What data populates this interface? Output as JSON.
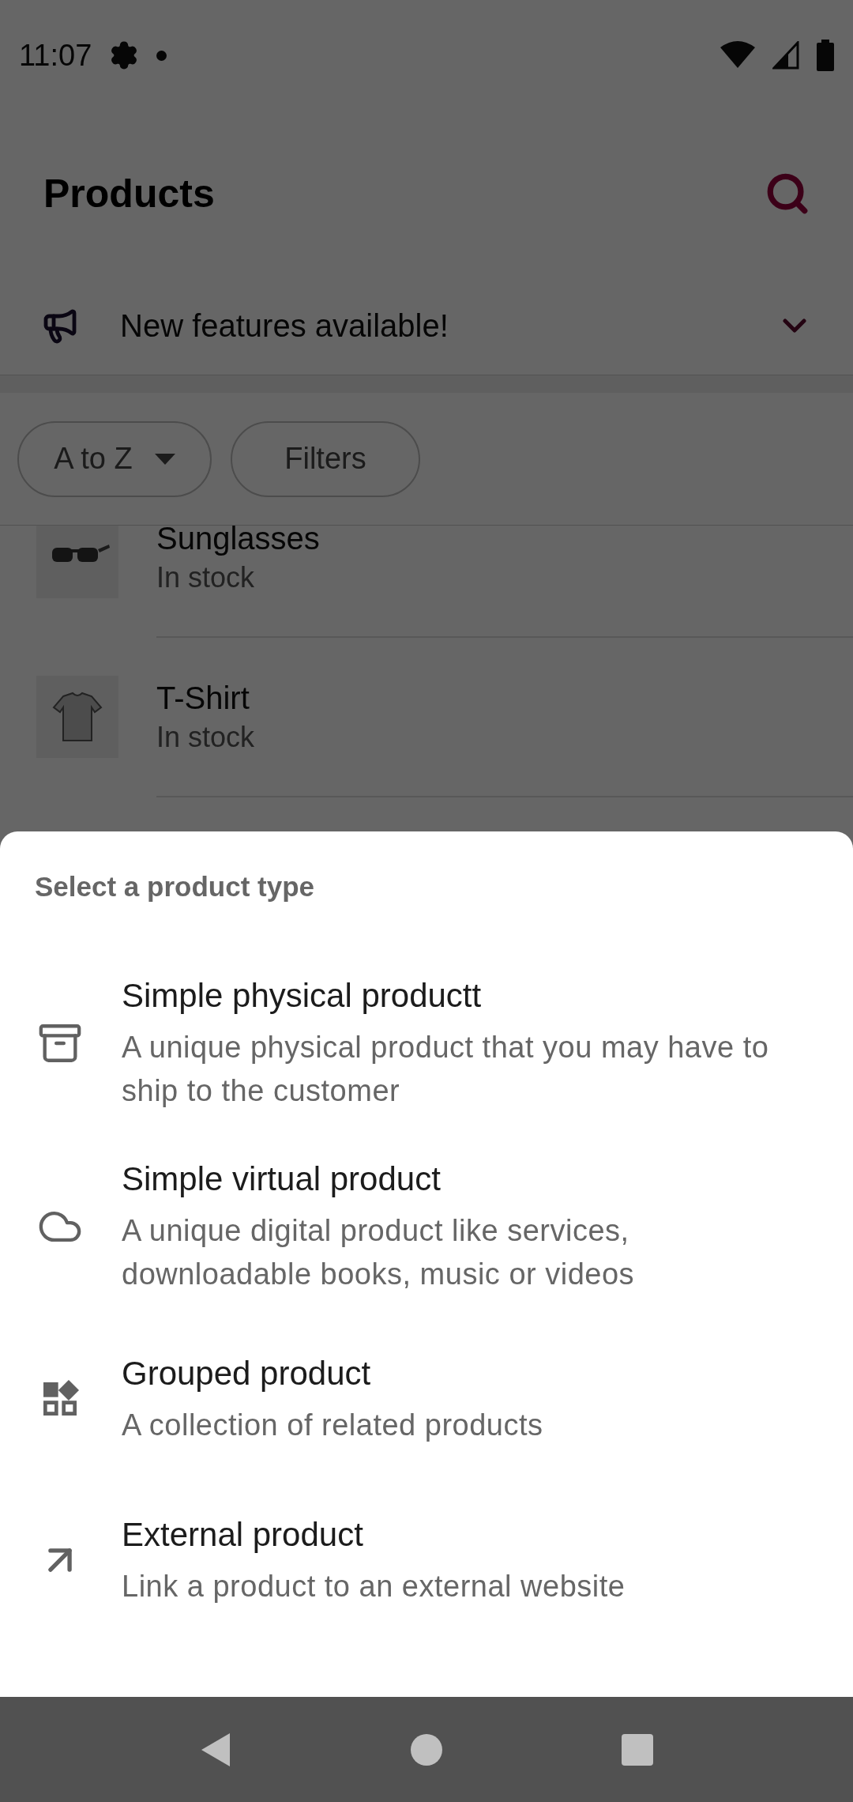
{
  "status_bar": {
    "time": "11:07"
  },
  "header": {
    "title": "Products"
  },
  "banner": {
    "text": "New features available!",
    "expanded": false
  },
  "sort_chip": {
    "label": "A to Z"
  },
  "filter_chip": {
    "label": "Filters"
  },
  "products": [
    {
      "name": "Sunglasses",
      "status": "In stock"
    },
    {
      "name": "T-Shirt",
      "status": "In stock"
    }
  ],
  "sheet": {
    "title": "Select a product type",
    "options": [
      {
        "kind": "physical",
        "title": "Simple physical productt",
        "description": "A unique physical product that you may have to ship to the customer"
      },
      {
        "kind": "virtual",
        "title": "Simple virtual product",
        "description": "A unique digital product like services, downloadable books, music or videos"
      },
      {
        "kind": "grouped",
        "title": "Grouped product",
        "description": "A collection of related products"
      },
      {
        "kind": "external",
        "title": "External product",
        "description": "Link a product to an external website"
      }
    ]
  }
}
